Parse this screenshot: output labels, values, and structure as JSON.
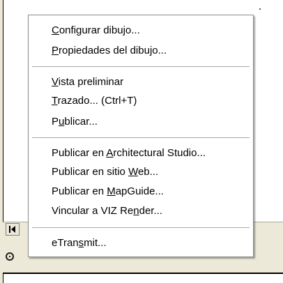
{
  "menu": {
    "items": [
      {
        "id": "configurar-dibujo",
        "before": "",
        "accel": "C",
        "after": "onfigurar dibujo..."
      },
      {
        "id": "propiedades-del-dibujo",
        "before": "",
        "accel": "P",
        "after": "ropiedades del dibujo..."
      },
      {
        "id": "vista-preliminar",
        "before": "",
        "accel": "V",
        "after": "ista preliminar"
      },
      {
        "id": "trazado",
        "before": "",
        "accel": "T",
        "after": "razado... (Ctrl+T)"
      },
      {
        "id": "publicar",
        "before": "P",
        "accel": "u",
        "after": "blicar..."
      },
      {
        "id": "publicar-architectural-studio",
        "before": "Publicar en ",
        "accel": "A",
        "after": "rchitectural Studio..."
      },
      {
        "id": "publicar-sitio-web",
        "before": "Publicar en sitio ",
        "accel": "W",
        "after": "eb..."
      },
      {
        "id": "publicar-mapguide",
        "before": "Publicar en ",
        "accel": "M",
        "after": "apGuide..."
      },
      {
        "id": "vincular-viz-render",
        "before": "Vincular a VIZ Re",
        "accel": "n",
        "after": "der..."
      },
      {
        "id": "etransmit",
        "before": "eTran",
        "accel": "s",
        "after": "mit..."
      }
    ]
  },
  "icons": {
    "scroll_first": "scroll-first-icon",
    "status": "snap-status-icon"
  },
  "colors": {
    "menu_background": "#ffffff",
    "separator": "#a8a8a8",
    "chrome_background": "#ece9d8"
  }
}
